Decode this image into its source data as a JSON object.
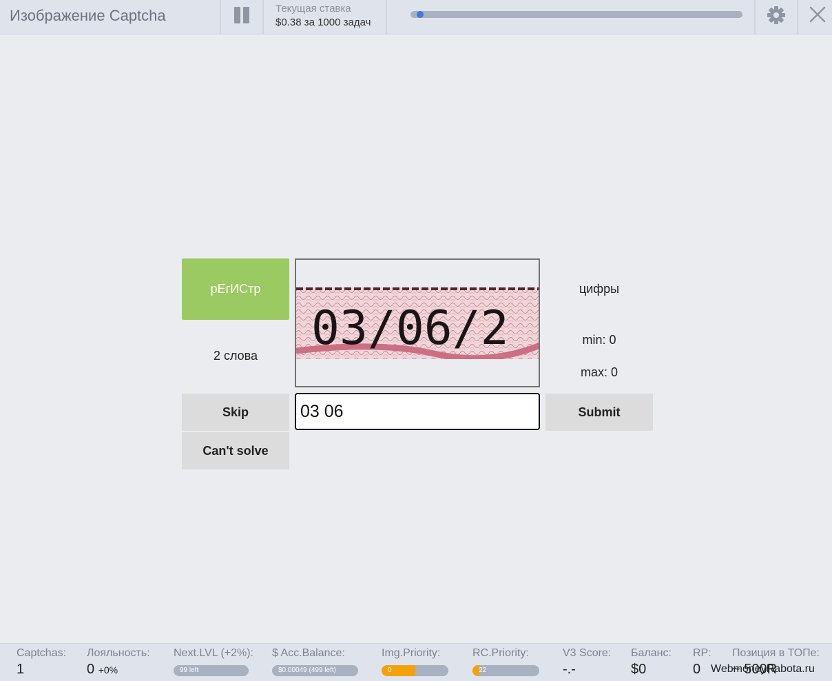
{
  "header": {
    "title": "Изображение Captcha",
    "rate_label": "Текущая ставка",
    "rate_value": "$0.38 за 1000 задач",
    "progress": 0.02,
    "icons": [
      "pause-icon",
      "gear-icon",
      "close-icon"
    ]
  },
  "task": {
    "case_button": "рЕгИСтр",
    "words_label": "2 слова",
    "type_label": "цифры",
    "min_label": "min: 0",
    "max_label": "max: 0",
    "captcha_text": "03/06/2",
    "answer_value": "03 06",
    "skip_label": "Skip",
    "cant_solve_label": "Can't solve",
    "submit_label": "Submit",
    "case_button_color": "#9bca62"
  },
  "footer": {
    "captchas": {
      "label": "Captchas:",
      "value": "1"
    },
    "loyalty": {
      "label": "Лояльность:",
      "value": "0",
      "delta": "+0%"
    },
    "next_lvl": {
      "label": "Next.LVL (+2%):",
      "bar_text": "99 left",
      "fill": 0.0
    },
    "acc_balance": {
      "label": "$ Acc.Balance:",
      "bar_text": "$0.00049 (499 left)",
      "fill": 0.0
    },
    "img_priority": {
      "label": "Img.Priority:",
      "bar_text": "0",
      "fill": 0.5
    },
    "rc_priority": {
      "label": "RC.Priority:",
      "bar_text": "22",
      "fill": 0.1
    },
    "v3_score": {
      "label": "V3 Score:",
      "value": "-.-"
    },
    "balance": {
      "label": "Баланс:",
      "value": "$0"
    },
    "rp": {
      "label": "RP:",
      "value": "0"
    },
    "top_position": {
      "label": "Позиция в ТОПе:",
      "value": "~ 500R"
    },
    "accent_color": "#f5a20a"
  },
  "watermark": "WebmoneyRabota.ru"
}
